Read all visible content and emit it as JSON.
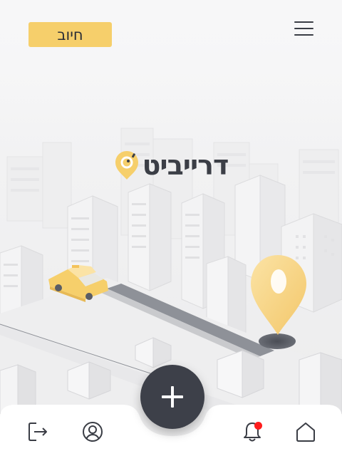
{
  "header": {
    "charge_label": "חיוב",
    "menu_icon": "hamburger-menu-icon"
  },
  "logo": {
    "text": "דרייביט",
    "icon": "location-pin-logo-icon",
    "accent": "#f6cf6b"
  },
  "fab": {
    "icon": "plus-icon"
  },
  "bottom_nav": [
    {
      "id": "logout",
      "icon": "logout-icon"
    },
    {
      "id": "profile",
      "icon": "user-circle-icon"
    },
    {
      "id": "notifications",
      "icon": "bell-icon",
      "has_badge": true
    },
    {
      "id": "home",
      "icon": "home-icon"
    }
  ],
  "colors": {
    "accent": "#f6cf6b",
    "dark": "#3d4049",
    "badge": "#ff1d1d",
    "background": "#f6f6f7"
  }
}
